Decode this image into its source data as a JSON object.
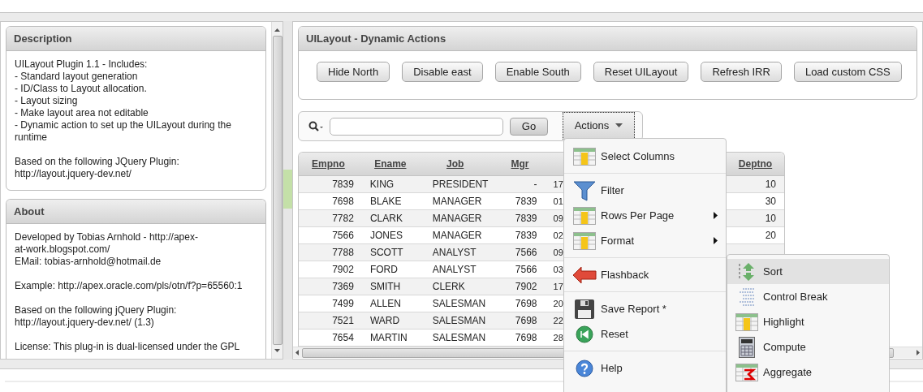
{
  "description_panel": {
    "title": "Description",
    "paragraphs": [
      "UILayout Plugin 1.1 - Includes:\n- Standard layout generation\n- ID/Class to Layout allocation.\n- Layout sizing\n- Make layout area not editable\n- Dynamic action to set up the UILayout during the\nruntime",
      "Based on the following JQuery Plugin:\nhttp://layout.jquery-dev.net/"
    ]
  },
  "about_panel": {
    "title": "About",
    "paragraphs": [
      "Developed by Tobias Arnhold - http://apex-\nat-work.blogspot.com/\nEMail: tobias-arnhold@hotmail.de",
      "Example: http://apex.oracle.com/pls/otn/f?p=65560:1",
      "Based on the following jQuery Plugin:\nhttp://layout.jquery-dev.net/ (1.3)",
      "License: This plug-in is dual-licensed under the GPL"
    ]
  },
  "dynamic_actions": {
    "title": "UILayout - Dynamic Actions",
    "buttons": [
      "Hide North",
      "Disable east",
      "Enable South",
      "Reset UILayout",
      "Refresh IRR",
      "Load custom CSS"
    ]
  },
  "report": {
    "go_button": "Go",
    "actions_button": "Actions",
    "columns": [
      "Empno",
      "Ename",
      "Job",
      "Mgr",
      "Deptno"
    ],
    "rows": [
      {
        "empno": "7839",
        "ename": "KING",
        "job": "PRESIDENT",
        "mgr": "-",
        "column_5": "17",
        "deptno": "10"
      },
      {
        "empno": "7698",
        "ename": "BLAKE",
        "job": "MANAGER",
        "mgr": "7839",
        "column_5": "01",
        "deptno": "30"
      },
      {
        "empno": "7782",
        "ename": "CLARK",
        "job": "MANAGER",
        "mgr": "7839",
        "column_5": "09",
        "deptno": "10"
      },
      {
        "empno": "7566",
        "ename": "JONES",
        "job": "MANAGER",
        "mgr": "7839",
        "column_5": "02",
        "deptno": "20"
      },
      {
        "empno": "7788",
        "ename": "SCOTT",
        "job": "ANALYST",
        "mgr": "7566",
        "column_5": "09"
      },
      {
        "empno": "7902",
        "ename": "FORD",
        "job": "ANALYST",
        "mgr": "7566",
        "column_5": "03"
      },
      {
        "empno": "7369",
        "ename": "SMITH",
        "job": "CLERK",
        "mgr": "7902",
        "column_5": "17"
      },
      {
        "empno": "7499",
        "ename": "ALLEN",
        "job": "SALESMAN",
        "mgr": "7698",
        "column_5": "20"
      },
      {
        "empno": "7521",
        "ename": "WARD",
        "job": "SALESMAN",
        "mgr": "7698",
        "column_5": "22"
      },
      {
        "empno": "7654",
        "ename": "MARTIN",
        "job": "SALESMAN",
        "mgr": "7698",
        "column_5": "28"
      }
    ]
  },
  "actions_menu": {
    "items": [
      {
        "kind": "item",
        "label": "Select Columns",
        "has_submenu": false
      },
      {
        "kind": "divider"
      },
      {
        "kind": "item",
        "label": "Filter",
        "has_submenu": false
      },
      {
        "kind": "item",
        "label": "Rows Per Page",
        "has_submenu": true
      },
      {
        "kind": "item",
        "label": "Format",
        "has_submenu": true
      },
      {
        "kind": "divider"
      },
      {
        "kind": "item",
        "label": "Flashback",
        "has_submenu": false
      },
      {
        "kind": "divider"
      },
      {
        "kind": "item",
        "label": "Save Report *",
        "has_submenu": false
      },
      {
        "kind": "item",
        "label": "Reset",
        "has_submenu": false
      },
      {
        "kind": "divider"
      },
      {
        "kind": "item",
        "label": "Help",
        "has_submenu": false
      }
    ]
  },
  "format_submenu": {
    "items": [
      {
        "label": "Sort",
        "selected": true
      },
      {
        "label": "Control Break",
        "selected": false
      },
      {
        "label": "Highlight",
        "selected": false
      },
      {
        "label": "Compute",
        "selected": false
      },
      {
        "label": "Aggregate",
        "selected": false
      }
    ]
  }
}
